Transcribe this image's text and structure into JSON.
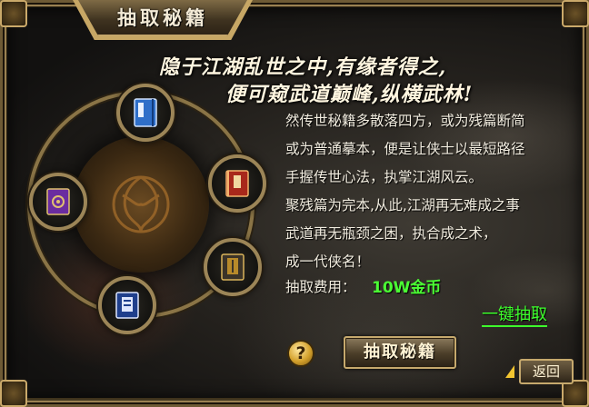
{
  "title": "抽取秘籍",
  "slogan": {
    "line1": "隐于江湖乱世之中,有缘者得之,",
    "line2": "便可窥武道巅峰,纵横武林!"
  },
  "description": [
    "然传世秘籍多散落四方，或为残篇断简",
    "或为普通摹本，便是让侠士以最短路径",
    "手握传世心法，执掌江湖风云。",
    "聚残篇为完本,从此,江湖再无难成之事",
    "武道再无瓶颈之困，执合成之术，",
    "成一代侠名！"
  ],
  "cost": {
    "label": "抽取费用：",
    "value": "10W金币"
  },
  "one_click_label": "一键抽取",
  "help_label": "?",
  "draw_button_label": "抽取秘籍",
  "back_button_label": "返回",
  "book_slots": [
    {
      "icon": "blue-manual-book-icon",
      "color": "#2f6fc9"
    },
    {
      "icon": "red-manual-book-icon",
      "color": "#a8281b"
    },
    {
      "icon": "gold-manual-book-icon",
      "color": "#b88a2a"
    },
    {
      "icon": "navy-manual-book-icon",
      "color": "#1f3f8c"
    },
    {
      "icon": "purple-manual-book-icon",
      "color": "#6a2ca0"
    }
  ],
  "colors": {
    "highlight_green": "#4bff34",
    "frame_gold": "#c7a765"
  }
}
